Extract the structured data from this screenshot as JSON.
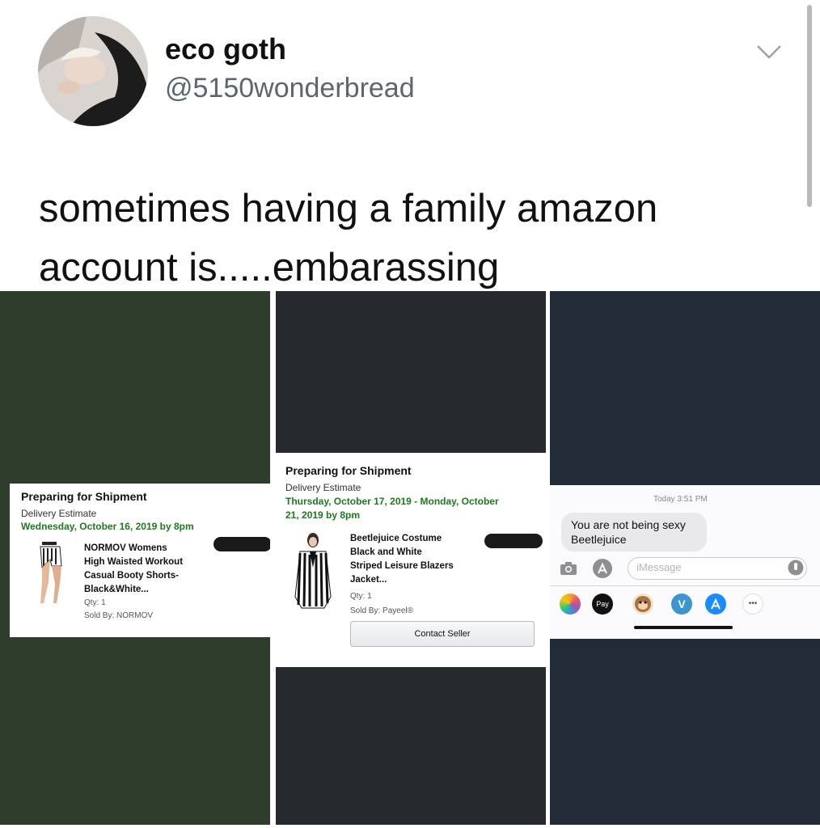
{
  "tweet": {
    "display_name": "eco goth",
    "handle": "@5150wonderbread",
    "text": "sometimes having a family amazon account is.....embarassing"
  },
  "order1": {
    "status": "Preparing for Shipment",
    "estimate_label": "Delivery Estimate",
    "estimate_date": "Wednesday, October 16, 2019 by 8pm",
    "product": [
      "NORMOV Womens",
      "High Waisted Workout",
      "Casual Booty Shorts-",
      "Black&White..."
    ],
    "qty": "Qty: 1",
    "sold_by": "Sold By: NORMOV"
  },
  "order2": {
    "status": "Preparing for Shipment",
    "estimate_label": "Delivery Estimate",
    "estimate_date": [
      "Thursday, October 17, 2019 - Monday, October",
      "21, 2019 by 8pm"
    ],
    "product": [
      "Beetlejuice Costume",
      "Black and White",
      "Striped Leisure Blazers",
      "Jacket..."
    ],
    "qty": "Qty: 1",
    "sold_by": "Sold By: Payeel®",
    "contact_button": "Contact Seller"
  },
  "imessage": {
    "timestamp": "Today 3:51 PM",
    "bubble": [
      "You are not being sexy",
      "Beetlejuice"
    ],
    "input_placeholder": "iMessage",
    "apple_pay_label": "Pay",
    "venmo_label": "V",
    "more_label": "•••",
    "icons": [
      "camera-icon",
      "app-store-icon",
      "microphone-icon",
      "photos-icon",
      "apple-pay-icon",
      "animoji-icon",
      "venmo-icon",
      "app-store-icon",
      "more-icon"
    ]
  },
  "colors": {
    "panel1_bg": "#2f3d2c",
    "panel2_bg": "#26292d",
    "panel3_bg": "#232b39",
    "estimate_green": "#1d7a1d",
    "handle_gray": "#5c6670"
  }
}
